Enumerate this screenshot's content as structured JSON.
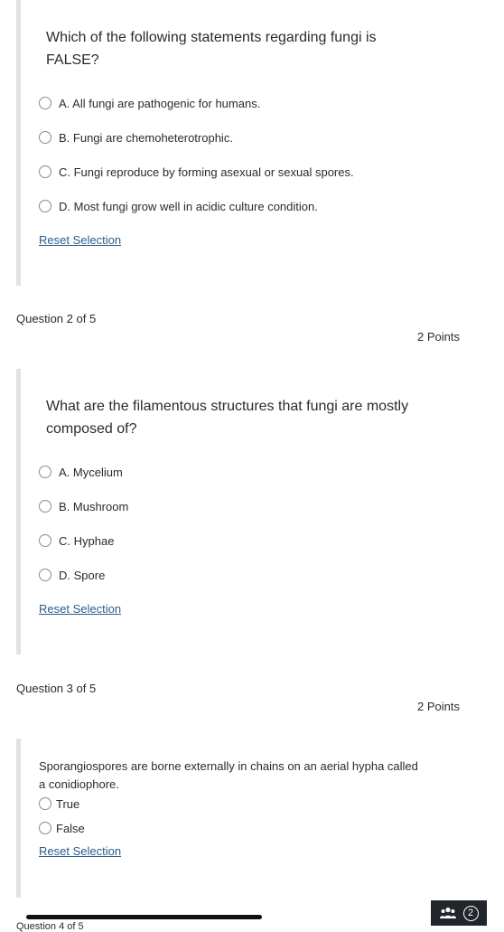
{
  "question1": {
    "text": "Which of the following statements regarding fungi is FALSE?",
    "options": [
      {
        "label": "A. All fungi are pathogenic for humans."
      },
      {
        "label": "B. Fungi are chemoheterotrophic."
      },
      {
        "label": "C. Fungi reproduce by forming asexual or sexual spores."
      },
      {
        "label": "D. Most fungi grow well in acidic culture condition."
      }
    ],
    "reset_label": "Reset Selection"
  },
  "question2": {
    "number_label": "Question 2 of 5",
    "points_label": "2 Points",
    "text": "What are the filamentous structures that fungi are mostly composed of?",
    "options": [
      {
        "label": "A. Mycelium"
      },
      {
        "label": "B. Mushroom"
      },
      {
        "label": "C. Hyphae"
      },
      {
        "label": "D. Spore"
      }
    ],
    "reset_label": "Reset Selection"
  },
  "question3": {
    "number_label": "Question 3 of 5",
    "points_label": "2 Points",
    "text": "Sporangiospores are borne externally in chains on an aerial hypha called a conidiophore.",
    "options": [
      {
        "label": "True"
      },
      {
        "label": "False"
      }
    ],
    "reset_label": "Reset Selection"
  },
  "peek_text": "Question 4 of 5",
  "dock": {
    "icon": "people-icon",
    "badge_count": "2"
  },
  "colors": {
    "link": "#2a5d8a",
    "card_border": "#e2e2e2",
    "dock_bg": "#20262c"
  }
}
